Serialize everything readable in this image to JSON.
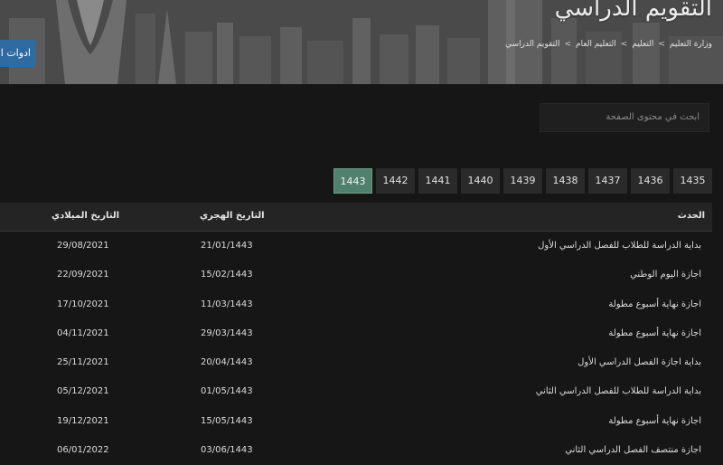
{
  "header": {
    "page_title": "التقويم الدراسي",
    "breadcrumb": [
      "وزارة التعليم",
      "التعليم",
      "التعليم العام",
      "التقويم الدراسي"
    ],
    "tools_button": "ادوات الـ"
  },
  "search": {
    "placeholder": "ابحث في محتوى الصفحة"
  },
  "years": {
    "items": [
      "1435",
      "1436",
      "1437",
      "1438",
      "1439",
      "1440",
      "1441",
      "1442",
      "1443"
    ],
    "active": "1443",
    "active_color": "#52806e"
  },
  "table": {
    "headers": {
      "event": "الحدث",
      "hijri": "التاريخ الهجري",
      "gregorian": "التاريخ الميلادي"
    },
    "rows": [
      {
        "event": "بداية الدراسة للطلاب للفصل الدراسي الأول",
        "hijri": "21/01/1443",
        "gregorian": "29/08/2021"
      },
      {
        "event": "اجازة اليوم الوطني",
        "hijri": "15/02/1443",
        "gregorian": "22/09/2021"
      },
      {
        "event": "اجازة نهاية أسبوع مطولة",
        "hijri": "11/03/1443",
        "gregorian": "17/10/2021"
      },
      {
        "event": "اجازة نهاية أسبوع مطولة",
        "hijri": "29/03/1443",
        "gregorian": "04/11/2021"
      },
      {
        "event": "بداية اجازة الفصل الدراسي الأول",
        "hijri": "20/04/1443",
        "gregorian": "25/11/2021"
      },
      {
        "event": "بداية الدراسة للطلاب للفصل الدراسي الثاني",
        "hijri": "01/05/1443",
        "gregorian": "05/12/2021"
      },
      {
        "event": "اجازة نهاية أسبوع مطولة",
        "hijri": "15/05/1443",
        "gregorian": "19/12/2021"
      },
      {
        "event": "اجازة منتصف الفصل الدراسي الثاني",
        "hijri": "03/06/1443",
        "gregorian": "06/01/2022"
      }
    ]
  }
}
